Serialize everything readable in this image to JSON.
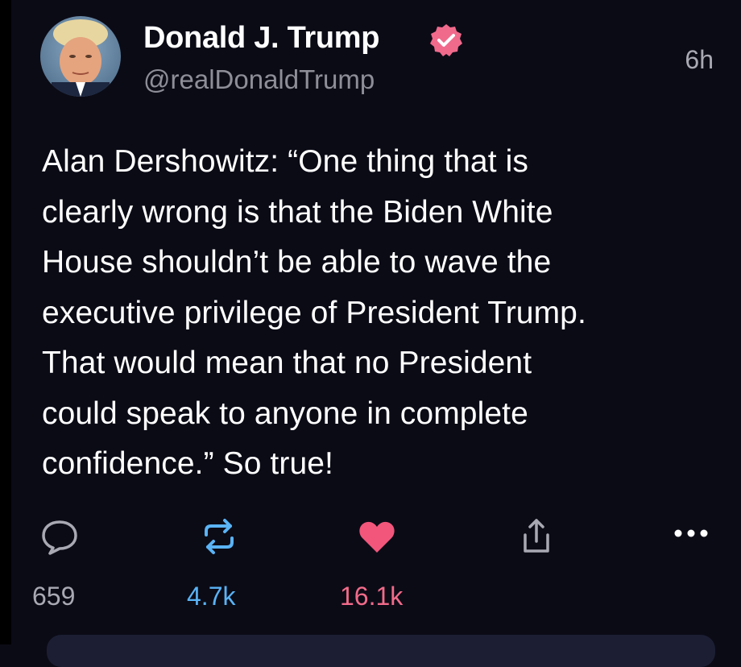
{
  "post": {
    "author_name": "Donald J. Trump",
    "author_handle": "@realDonaldTrump",
    "timestamp": "6h",
    "text": "Alan Dershowitz: “One thing that is\nclearly wrong is that the Biden White\nHouse shouldn’t be able to wave the\nexecutive privilege of President Trump.\nThat would mean that no President\ncould speak to anyone in complete\nconfidence.” So true!",
    "verified": true
  },
  "actions": {
    "reply_count": "659",
    "repost_count": "4.7k",
    "like_count": "16.1k"
  },
  "icons": {
    "reply": "speech-bubble-icon",
    "repost": "repost-arrows-icon",
    "like": "heart-icon",
    "share": "share-icon",
    "more": "ellipsis-icon",
    "verified": "verified-badge-icon"
  },
  "colors": {
    "background": "#0b0b16",
    "verified_badge": "#f06a8c",
    "repost": "#5ab3f5",
    "like": "#f2567b",
    "muted": "#8e8e98"
  }
}
